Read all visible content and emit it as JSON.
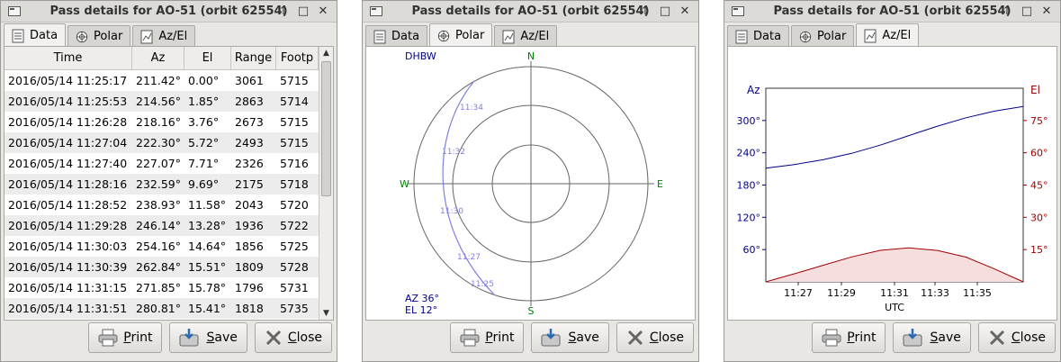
{
  "window_title": "Pass details for AO-51 (orbit 62554)",
  "title_buttons": {
    "up": "↑",
    "max": "□",
    "close": "✕"
  },
  "tabs": [
    "Data",
    "Polar",
    "Az/El"
  ],
  "buttons": {
    "print": "Print",
    "save": "Save",
    "close": "Close"
  },
  "colors": {
    "accent_blue": "#00008b",
    "accent_red": "#a00000",
    "track": "#8080e0",
    "compass": "#008000"
  },
  "table": {
    "headers": [
      "Time",
      "Az",
      "El",
      "Range",
      "Footp"
    ],
    "rows": [
      [
        "2016/05/14 11:25:17",
        "211.42°",
        "0.00°",
        "3061",
        "5715"
      ],
      [
        "2016/05/14 11:25:53",
        "214.56°",
        "1.85°",
        "2863",
        "5714"
      ],
      [
        "2016/05/14 11:26:28",
        "218.16°",
        "3.76°",
        "2673",
        "5715"
      ],
      [
        "2016/05/14 11:27:04",
        "222.30°",
        "5.72°",
        "2493",
        "5715"
      ],
      [
        "2016/05/14 11:27:40",
        "227.07°",
        "7.71°",
        "2326",
        "5716"
      ],
      [
        "2016/05/14 11:28:16",
        "232.59°",
        "9.69°",
        "2175",
        "5718"
      ],
      [
        "2016/05/14 11:28:52",
        "238.93°",
        "11.58°",
        "2043",
        "5720"
      ],
      [
        "2016/05/14 11:29:28",
        "246.14°",
        "13.28°",
        "1936",
        "5722"
      ],
      [
        "2016/05/14 11:30:03",
        "254.16°",
        "14.64°",
        "1856",
        "5725"
      ],
      [
        "2016/05/14 11:30:39",
        "262.84°",
        "15.51°",
        "1809",
        "5728"
      ],
      [
        "2016/05/14 11:31:15",
        "271.85°",
        "15.78°",
        "1796",
        "5731"
      ],
      [
        "2016/05/14 11:31:51",
        "280.81°",
        "15.41°",
        "1818",
        "5735"
      ]
    ]
  },
  "polar": {
    "station": "DHBW",
    "compass": {
      "n": "N",
      "s": "S",
      "e": "E",
      "w": "W"
    },
    "track_labels": [
      "11:34",
      "11:32",
      "11:30",
      "11:27",
      "11:25"
    ],
    "cursor_az": "AZ 36°",
    "cursor_el": "EL 12°"
  },
  "chart_data": {
    "type": "area",
    "x": [
      "11:25:17",
      "11:26:28",
      "11:27:40",
      "11:28:52",
      "11:30:03",
      "11:31:15",
      "11:32:27",
      "11:33:39",
      "11:34:50",
      "11:36:00"
    ],
    "xticks": [
      "11:27",
      "11:29",
      "11:31",
      "11:33",
      "11:35"
    ],
    "xlabel": "UTC",
    "ylabel_left": "Az",
    "ylabel_right": "El",
    "yticks_left": [
      "60°",
      "120°",
      "180°",
      "240°",
      "300°"
    ],
    "yticks_right": [
      "15°",
      "30°",
      "45°",
      "60°",
      "75°"
    ],
    "ylim_left": [
      0,
      360
    ],
    "ylim_right": [
      0,
      90
    ],
    "series": [
      {
        "name": "Az",
        "axis": "left",
        "color": "#00008b",
        "values": [
          211.42,
          218.16,
          227.07,
          238.93,
          254.16,
          271.85,
          289.5,
          305.0,
          317.5,
          326.0
        ]
      },
      {
        "name": "El",
        "axis": "right",
        "color": "#a00000",
        "fill": "#f7dede",
        "values": [
          0.0,
          3.76,
          7.71,
          11.58,
          14.64,
          15.78,
          14.6,
          11.5,
          6.0,
          0.0
        ]
      }
    ]
  }
}
